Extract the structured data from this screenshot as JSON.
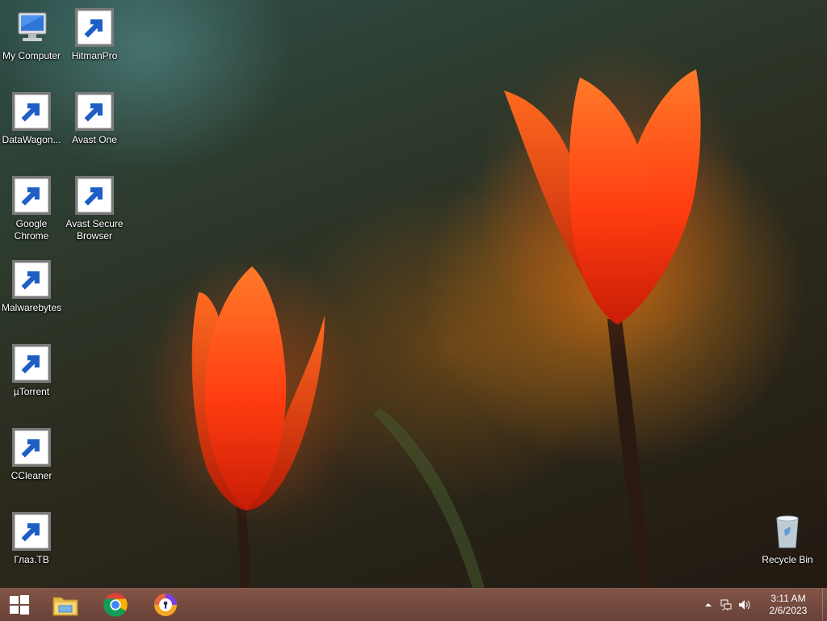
{
  "desktop": {
    "icons": [
      {
        "label": "My Computer",
        "icon": "computer-icon"
      },
      {
        "label": "HitmanPro",
        "icon": "hitmanpro-icon"
      },
      {
        "label": "DataWagon...",
        "icon": "datawagon-icon"
      },
      {
        "label": "Avast One",
        "icon": "avast-one-icon"
      },
      {
        "label": "Google Chrome",
        "icon": "chrome-icon"
      },
      {
        "label": "Avast Secure Browser",
        "icon": "avast-secure-browser-icon"
      },
      {
        "label": "Malwarebytes",
        "icon": "malwarebytes-icon"
      },
      {
        "label": "µTorrent",
        "icon": "file-icon"
      },
      {
        "label": "CCleaner",
        "icon": "ccleaner-icon"
      },
      {
        "label": "Глаз.ТВ",
        "icon": "glaz-tv-icon"
      },
      {
        "label": "Recycle Bin",
        "icon": "recycle-bin-icon"
      }
    ]
  },
  "taskbar": {
    "start": {
      "icon": "windows-logo-icon"
    },
    "pinned": [
      {
        "icon": "file-explorer-icon"
      },
      {
        "icon": "chrome-icon"
      },
      {
        "icon": "avast-secure-browser-icon"
      }
    ],
    "tray": {
      "icons": [
        "show-hidden-icons-icon",
        "network-icon",
        "volume-icon"
      ],
      "time": "3:11 AM",
      "date": "2/6/2023"
    }
  },
  "colors": {
    "taskbar": "#6e4234",
    "flower": "#ff4a14",
    "text": "#ffffff"
  }
}
